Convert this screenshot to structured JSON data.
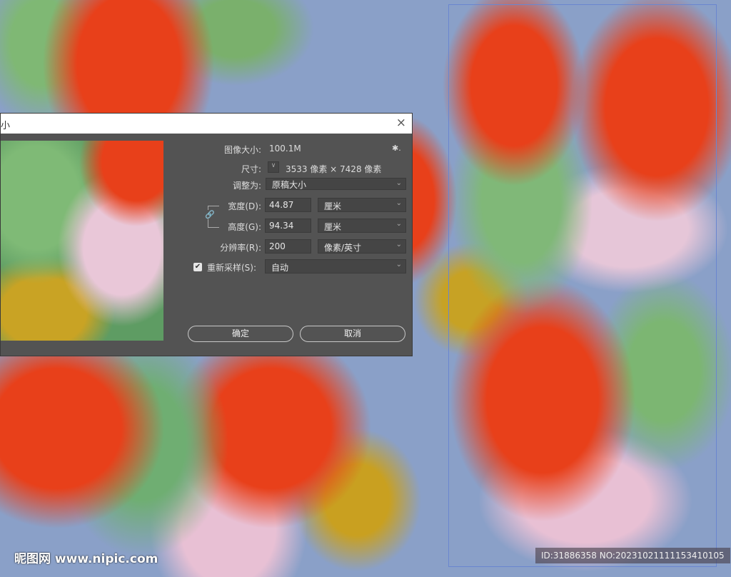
{
  "dialog": {
    "title": "小",
    "close": "×",
    "image_size_label": "图像大小:",
    "image_size_value": "100.1M",
    "gear": "✱.",
    "dimensions_label": "尺寸:",
    "dimensions_value": "3533 像素 × 7428 像素",
    "fit_to_label": "调整为:",
    "fit_to_value": "原稿大小",
    "width_label": "宽度(D):",
    "width_value": "44.87",
    "width_unit": "厘米",
    "height_label": "高度(G):",
    "height_value": "94.34",
    "height_unit": "厘米",
    "resolution_label": "分辨率(R):",
    "resolution_value": "200",
    "resolution_unit": "像素/英寸",
    "resample_label": "重新采样(S):",
    "resample_checked": true,
    "resample_value": "自动",
    "ok": "确定",
    "cancel": "取消"
  },
  "watermark": {
    "logo": "昵图网 www.nipic.com",
    "id": "ID:31886358 NO:20231021111153410105"
  }
}
